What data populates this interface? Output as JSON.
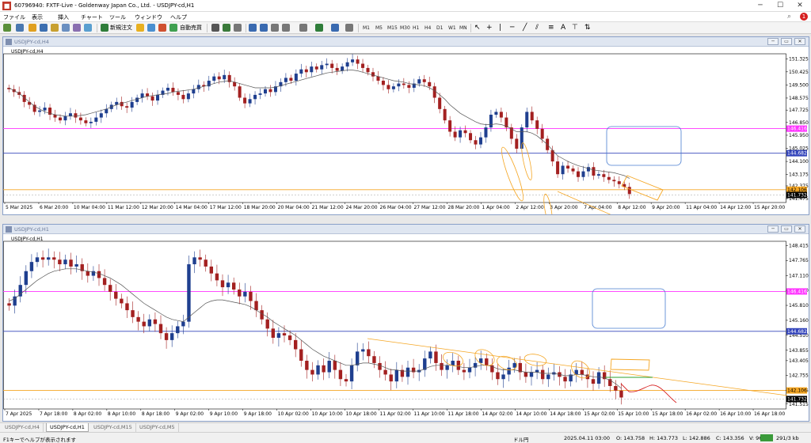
{
  "titlebar": {
    "title": "60796940: FXTF-Live - Goldenway Japan Co., Ltd. - USDJPY-cd,H1"
  },
  "menu": {
    "items": [
      "ファイル",
      "表示",
      "挿入",
      "チャート",
      "ツール",
      "ウィンドウ",
      "ヘルプ"
    ]
  },
  "toolbar": {
    "new_order": "新規注文",
    "auto_trading": "自動売買",
    "timeframes": [
      "M1",
      "M5",
      "M15",
      "M30",
      "H1",
      "H4",
      "D1",
      "W1",
      "MN"
    ]
  },
  "colors": {
    "bull": "#1f3f8f",
    "bear": "#a32020",
    "ma": "#555555",
    "magenta": "#ff33ff",
    "blue": "#3344bb",
    "orange": "#f5a623",
    "green": "#2ca02c",
    "red": "#d62020"
  },
  "chart1": {
    "label": "USDJPY-cd,H4",
    "window_title": "USDJPY-cd,H4",
    "price_labels": [
      "151.325",
      "150.425",
      "149.500",
      "148.575",
      "147.725",
      "146.850",
      "145.950",
      "145.025",
      "144.100",
      "143.175",
      "142.375",
      "141.475"
    ],
    "magenta_label": "146.416",
    "blue_label": "144.682",
    "orange_label": "142.106",
    "current_label": "141.732",
    "time_labels": [
      "5 Mar 2025",
      "6 Mar 20:00",
      "10 Mar 04:00",
      "11 Mar 12:00",
      "12 Mar 20:00",
      "14 Mar 04:00",
      "17 Mar 12:00",
      "18 Mar 20:00",
      "20 Mar 04:00",
      "21 Mar 12:00",
      "24 Mar 20:00",
      "26 Mar 04:00",
      "27 Mar 12:00",
      "28 Mar 20:00",
      "1 Apr 04:00",
      "2 Apr 12:00",
      "3 Apr 20:00",
      "7 Apr 04:00",
      "8 Apr 12:00",
      "9 Apr 20:00",
      "11 Apr 04:00",
      "14 Apr 12:00",
      "15 Apr 20:00"
    ],
    "closes": [
      149.2,
      149.0,
      148.8,
      148.3,
      148.1,
      147.6,
      147.7,
      147.9,
      147.4,
      147.2,
      147.0,
      147.3,
      147.5,
      147.2,
      147.0,
      146.8,
      146.9,
      147.2,
      147.5,
      147.8,
      148.1,
      148.3,
      148.0,
      147.9,
      148.3,
      148.6,
      148.9,
      148.7,
      148.4,
      148.8,
      149.1,
      149.3,
      149.0,
      148.8,
      148.5,
      148.9,
      149.2,
      149.5,
      149.4,
      149.8,
      150.1,
      149.9,
      150.2,
      149.7,
      149.4,
      148.6,
      148.2,
      148.5,
      148.8,
      148.9,
      149.2,
      149.0,
      149.4,
      149.7,
      150.0,
      149.8,
      150.3,
      150.6,
      150.4,
      150.8,
      150.6,
      150.9,
      151.0,
      150.7,
      150.5,
      150.8,
      151.1,
      151.3,
      151.0,
      150.7,
      150.4,
      150.1,
      149.8,
      149.5,
      149.2,
      149.4,
      149.6,
      149.5,
      149.3,
      149.6,
      149.9,
      149.7,
      149.4,
      148.6,
      147.8,
      147.0,
      146.2,
      145.8,
      146.3,
      146.1,
      145.6,
      145.3,
      145.8,
      146.5,
      147.4,
      147.6,
      147.2,
      146.5,
      145.7,
      145.0,
      146.5,
      147.6,
      147.0,
      146.4,
      145.7,
      144.9,
      144.1,
      143.2,
      143.8,
      143.6,
      143.4,
      143.0,
      143.4,
      143.7,
      143.1,
      143.2,
      143.0,
      142.8,
      142.7,
      142.5,
      142.3,
      141.8
    ],
    "ma_values": [
      149.3,
      149.1,
      148.9,
      148.6,
      148.3,
      148.0,
      147.8,
      147.6,
      147.5,
      147.4,
      147.35,
      147.3,
      147.3,
      147.3,
      147.35,
      147.4,
      147.5,
      147.6,
      147.7,
      147.8,
      147.95,
      148.1,
      148.2,
      148.3,
      148.4,
      148.5,
      148.6,
      148.7,
      148.75,
      148.8,
      148.85,
      148.9,
      149.0,
      149.05,
      149.1,
      149.15,
      149.2,
      149.3,
      149.4,
      149.5,
      149.6,
      149.7,
      149.75,
      149.8,
      149.7,
      149.6,
      149.5,
      149.4,
      149.3,
      149.3,
      149.3,
      149.3,
      149.35,
      149.45,
      149.55,
      149.65,
      149.75,
      149.85,
      149.95,
      150.05,
      150.15,
      150.25,
      150.35,
      150.4,
      150.45,
      150.5,
      150.55,
      150.55,
      150.5,
      150.4,
      150.3,
      150.2,
      150.1,
      150.0,
      149.9,
      149.8,
      149.75,
      149.7,
      149.6,
      149.55,
      149.5,
      149.45,
      149.3,
      149.1,
      148.8,
      148.5,
      148.1,
      147.8,
      147.5,
      147.3,
      147.1,
      146.9,
      146.75,
      146.7,
      146.7,
      146.75,
      146.7,
      146.6,
      146.4,
      146.2,
      146.2,
      146.2,
      146.1,
      145.9,
      145.6,
      145.3,
      144.9,
      144.5,
      144.3,
      144.1,
      143.95,
      143.8,
      143.7,
      143.6,
      143.5,
      143.45,
      143.4,
      143.35,
      143.3,
      143.2,
      143.1,
      142.9
    ]
  },
  "chart2": {
    "label": "USDJPY-cd,H1",
    "window_title": "USDJPY-cd,H1",
    "price_labels": [
      "148.415",
      "147.765",
      "147.110",
      "146.460",
      "145.810",
      "145.160",
      "144.510",
      "143.855",
      "143.405",
      "142.755",
      "142.105",
      "141.515"
    ],
    "magenta_label": "146.416",
    "blue_label": "144.682",
    "orange_label": "142.106",
    "current_label": "141.732",
    "time_labels": [
      "7 Apr 2025",
      "7 Apr 18:00",
      "8 Apr 02:00",
      "8 Apr 10:00",
      "8 Apr 18:00",
      "9 Apr 02:00",
      "9 Apr 10:00",
      "9 Apr 18:00",
      "10 Apr 02:00",
      "10 Apr 10:00",
      "10 Apr 18:00",
      "11 Apr 02:00",
      "11 Apr 10:00",
      "11 Apr 18:00",
      "14 Apr 02:00",
      "14 Apr 10:00",
      "14 Apr 18:00",
      "15 Apr 02:00",
      "15 Apr 10:00",
      "15 Apr 18:00",
      "16 Apr 02:00",
      "16 Apr 10:00",
      "16 Apr 18:00"
    ],
    "closes": [
      145.8,
      146.2,
      146.7,
      147.3,
      147.7,
      147.9,
      147.8,
      147.9,
      147.8,
      147.6,
      147.8,
      147.5,
      147.6,
      147.3,
      147.1,
      147.3,
      147.0,
      146.7,
      146.4,
      146.1,
      145.9,
      145.6,
      145.3,
      145.1,
      144.9,
      145.2,
      145.0,
      144.6,
      144.3,
      144.6,
      144.9,
      145.1,
      147.6,
      147.9,
      147.8,
      147.5,
      147.2,
      146.9,
      146.6,
      146.8,
      146.5,
      146.2,
      146.4,
      146.0,
      145.6,
      145.2,
      144.8,
      144.4,
      144.6,
      144.5,
      144.3,
      143.9,
      143.4,
      143.0,
      142.8,
      143.2,
      142.9,
      143.4,
      143.0,
      142.6,
      142.5,
      143.2,
      143.8,
      143.9,
      143.6,
      143.3,
      143.0,
      142.8,
      142.5,
      143.0,
      142.7,
      143.1,
      142.9,
      143.0,
      143.5,
      143.8,
      143.3,
      143.0,
      143.2,
      143.4,
      143.0,
      142.9,
      143.1,
      143.3,
      143.5,
      143.2,
      142.9,
      142.6,
      142.8,
      143.1,
      143.3,
      142.9,
      142.7,
      142.9,
      143.0,
      142.6,
      142.8,
      142.9,
      142.7,
      142.5,
      142.8,
      143.0,
      142.8,
      142.6,
      142.4,
      142.9,
      142.6,
      142.3,
      142.1,
      141.8
    ],
    "ma_values": [
      146.0,
      146.1,
      146.3,
      146.5,
      146.7,
      146.9,
      147.05,
      147.2,
      147.3,
      147.35,
      147.4,
      147.4,
      147.4,
      147.35,
      147.3,
      147.25,
      147.2,
      147.1,
      147.0,
      146.85,
      146.7,
      146.5,
      146.3,
      146.1,
      145.9,
      145.75,
      145.6,
      145.45,
      145.3,
      145.2,
      145.15,
      145.1,
      145.3,
      145.5,
      145.7,
      145.9,
      146.0,
      146.05,
      146.05,
      146.0,
      145.95,
      145.9,
      145.85,
      145.75,
      145.6,
      145.45,
      145.3,
      145.1,
      144.95,
      144.8,
      144.65,
      144.5,
      144.3,
      144.1,
      143.9,
      143.75,
      143.6,
      143.5,
      143.4,
      143.3,
      143.2,
      143.2,
      143.25,
      143.3,
      143.3,
      143.25,
      143.2,
      143.1,
      143.0,
      143.0,
      142.95,
      142.95,
      142.95,
      142.95,
      143.05,
      143.15,
      143.2,
      143.2,
      143.2,
      143.2,
      143.15,
      143.1,
      143.1,
      143.15,
      143.2,
      143.2,
      143.15,
      143.05,
      143.0,
      143.0,
      143.0,
      142.95,
      142.9,
      142.9,
      142.9,
      142.85,
      142.85,
      142.85,
      142.8,
      142.75,
      142.75,
      142.8,
      142.8,
      142.75,
      142.7,
      142.7,
      142.65,
      142.55,
      142.4,
      142.2
    ]
  },
  "tabs": [
    "USDJPY-cd,H4",
    "USDJPY-cd,H1",
    "USDJPY-cd,M15",
    "USDJPY-cd,M5"
  ],
  "status": {
    "help": "F1キーでヘルプが表示されます",
    "currency": "ドル円",
    "datetime": "2025.04.11 03:00",
    "open": "O: 143.758",
    "high": "H: 143.773",
    "low": "L: 142.886",
    "close": "C: 143.356",
    "volume": "V: 9668",
    "traffic": "291/3 kb"
  }
}
